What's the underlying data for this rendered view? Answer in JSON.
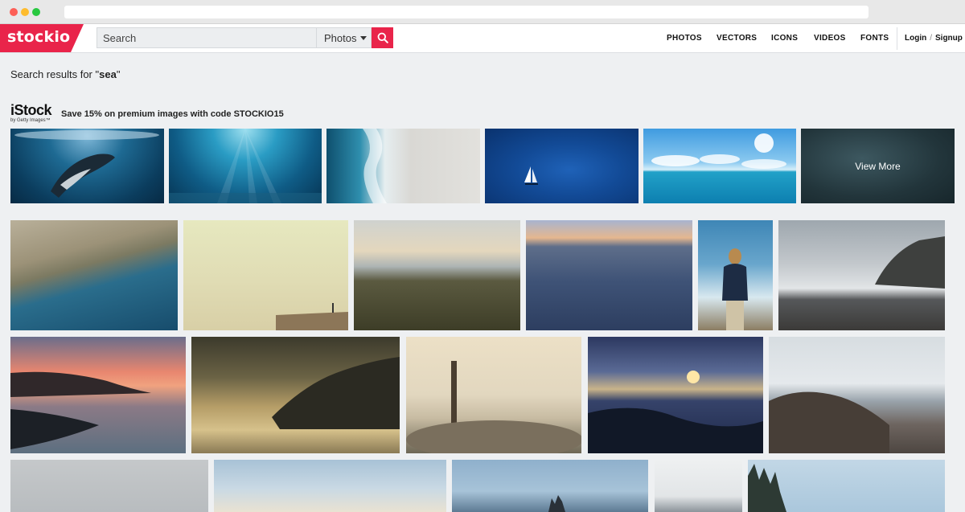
{
  "header": {
    "logo_text": "stockio",
    "search_placeholder": "Search",
    "search_type": "Photos",
    "nav": [
      "PHOTOS",
      "VECTORS",
      "ICONS",
      "VIDEOS",
      "FONTS"
    ],
    "login": "Login",
    "separator": "/",
    "signup": "Signup"
  },
  "results": {
    "prefix": "Search results for \"",
    "query": "sea",
    "suffix": "\""
  },
  "promo": {
    "brand": "iStock",
    "brand_sub": "by Getty Images™",
    "text": "Save 15% on premium images with code STOCKIO15",
    "view_more": "View More"
  },
  "colors": {
    "brand": "#e9244a",
    "background": "#eef0f2"
  },
  "icons": {
    "search": "magnifier-icon",
    "dropdown": "caret-down-icon"
  }
}
